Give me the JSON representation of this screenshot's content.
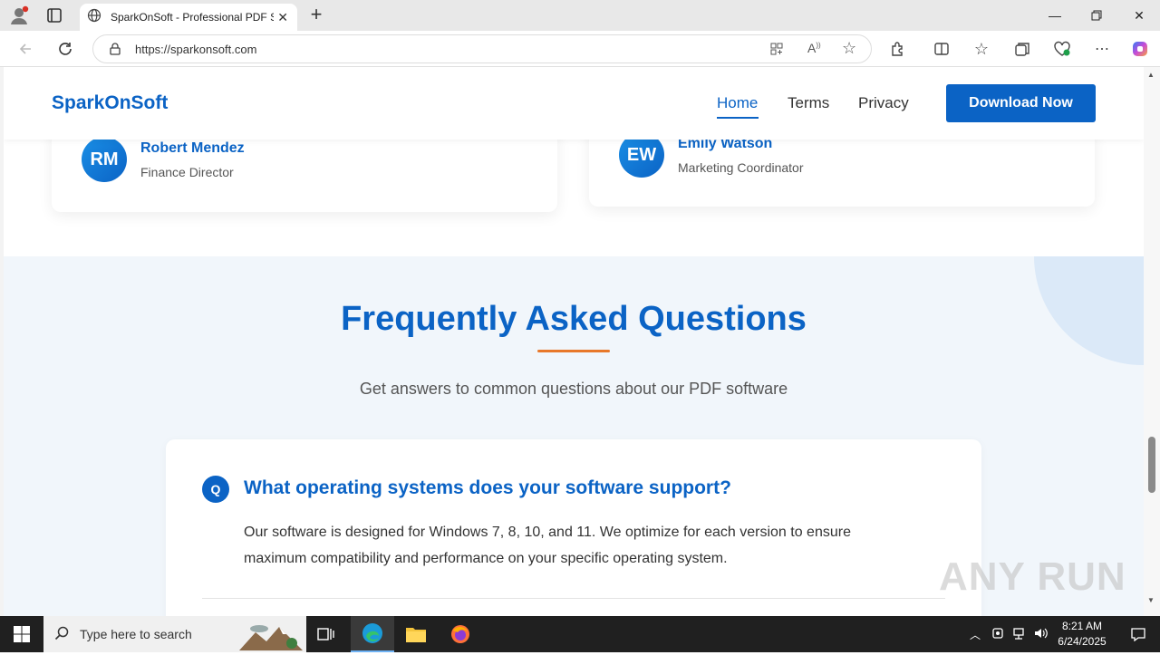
{
  "browser": {
    "tab_title": "SparkOnSoft - Professional PDF S",
    "url": "https://sparkonsoft.com"
  },
  "site": {
    "brand": "SparkOnSoft",
    "nav": [
      {
        "label": "Home",
        "active": true
      },
      {
        "label": "Terms",
        "active": false
      },
      {
        "label": "Privacy",
        "active": false
      }
    ],
    "download_label": "Download Now"
  },
  "testimonials": [
    {
      "initials": "RM",
      "name": "Robert Mendez",
      "role": "Finance Director"
    },
    {
      "initials": "EW",
      "name": "Emily Watson",
      "role": "Marketing Coordinator"
    }
  ],
  "faq": {
    "title": "Frequently Asked Questions",
    "subtitle": "Get answers to common questions about our PDF software",
    "items": [
      {
        "badge": "Q",
        "question": "What operating systems does your software support?",
        "answer": "Our software is designed for Windows 7, 8, 10, and 11. We optimize for each version to ensure maximum compatibility and performance on your specific operating system."
      }
    ]
  },
  "watermark": "ANY RUN",
  "taskbar": {
    "search_placeholder": "Type here to search",
    "time": "8:21 AM",
    "date": "6/24/2025"
  },
  "colors": {
    "brand_blue": "#0b63c5",
    "accent_orange": "#e8782a",
    "section_bg": "#f1f6fb"
  }
}
